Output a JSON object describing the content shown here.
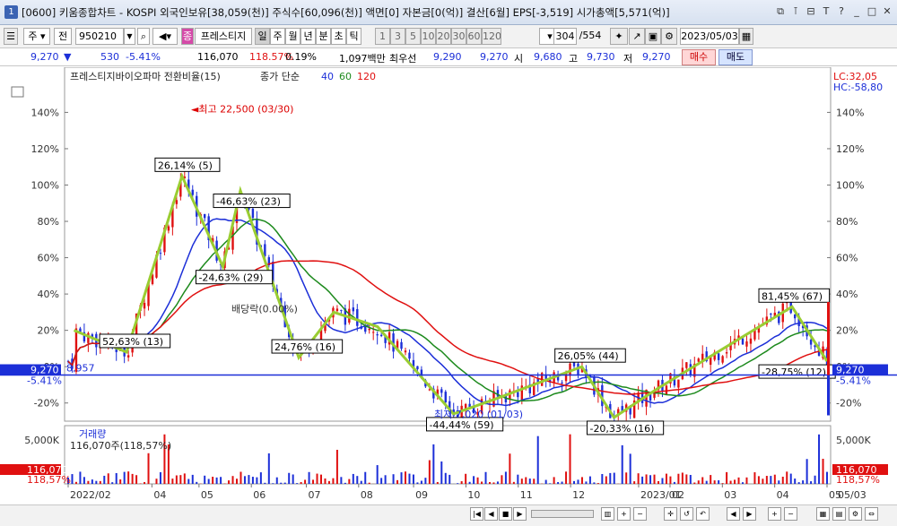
{
  "window": {
    "title": "[0600] 키움종합차트 - KOSPI 외국인보유[38,059(천)] 주식수[60,096(천)] 액면[0] 자본금[0(억)] 결산[6월] EPS[-3,519] 시가총액[5,571(억)]",
    "icon": "1"
  },
  "toolbar": {
    "period_select": "주",
    "prev_label": "전",
    "code": "950210",
    "name_badge": "종",
    "stock_name": "프레스티지",
    "period_buttons": [
      "일",
      "주",
      "월",
      "년",
      "분",
      "초",
      "틱"
    ],
    "interval_buttons": [
      "1",
      "3",
      "5",
      "10",
      "20",
      "30",
      "60",
      "120"
    ],
    "count": "304",
    "total": "/554",
    "date": "2023/05/03"
  },
  "quote": {
    "price": "9,270",
    "change": "530",
    "change_pct": "-5.41%",
    "volume": "116,070",
    "vol_ratio": "118.57%",
    "turnover": "0.19%",
    "amount": "1,097백만",
    "best_ask_label": "최우선",
    "best_ask": "9,290",
    "best_bid": "9,270",
    "open_label": "시",
    "open": "9,680",
    "high_label": "고",
    "high": "9,730",
    "low_label": "저",
    "low": "9,270",
    "buy_label": "매수",
    "sell_label": "매도"
  },
  "chart_data": {
    "type": "line",
    "legend_stock": "프레스티지바이오파마 전환비율(15)",
    "legend_ma_label": "종가 단순",
    "ma_periods": [
      "40",
      "60",
      "120"
    ],
    "lc_label": "LC:32,05",
    "hc_label": "HC:-58,80",
    "y_ticks": [
      "140%",
      "120%",
      "100%",
      "80%",
      "60%",
      "40%",
      "20%",
      "0%",
      "-20%"
    ],
    "x_labels": [
      "2022/02",
      "04",
      "05",
      "06",
      "07",
      "08",
      "09",
      "10",
      "11",
      "12",
      "2023/01",
      "02",
      "03",
      "04",
      "05"
    ],
    "x_right_label": "05/03",
    "current_price_tag": "9,270",
    "current_pct_tag": "-5.41%",
    "baseline_label": "8,957",
    "high_annotation": "최고 22,500 (03/30)",
    "low_annotation": "최저 7,020 (01/03)",
    "dividend_annotation": "배당락(0.00%)",
    "zigzag_labels": [
      "52,63% (13)",
      "26,14% (5)",
      "-24,63% (29)",
      "24,76% (16)",
      "-46,63% (23)",
      "26,05% (44)",
      "-44,44% (59)",
      "-20,33% (16)",
      "81,45% (67)",
      "-28,75% (12)"
    ],
    "zigzag_points": [
      [
        0.2,
        20
      ],
      [
        2,
        8
      ],
      [
        3.9,
        105
      ],
      [
        5.3,
        55
      ],
      [
        5.9,
        97
      ],
      [
        7.9,
        5
      ],
      [
        9.1,
        30
      ],
      [
        10.6,
        22
      ],
      [
        13.2,
        -26
      ],
      [
        14.6,
        -18
      ],
      [
        17.6,
        0
      ],
      [
        18.7,
        -28
      ],
      [
        20.2,
        -12
      ],
      [
        24.8,
        33
      ],
      [
        26.0,
        3
      ]
    ],
    "volume_title": "거래량",
    "volume_value": "116,070주(118,57%)",
    "volume_tick": "5,000K",
    "volume_tag": "116,070",
    "volume_pct_tag": "118,57%"
  },
  "colors": {
    "ma40": "#1c2fd8",
    "ma60": "#1d8a1d",
    "ma120": "#e01010",
    "zigzag": "#9acd32",
    "up": "#e01010",
    "down": "#1c2fd8"
  }
}
